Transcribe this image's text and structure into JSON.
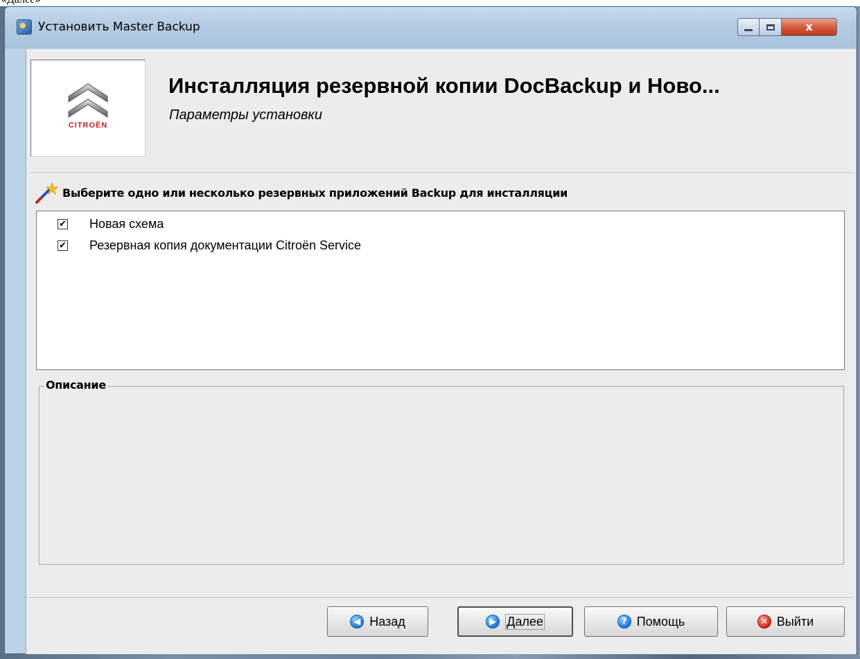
{
  "document_fragment": "«Далее»",
  "window": {
    "title": "Установить Master Backup",
    "controls": {
      "minimize_icon": "minimize-icon",
      "maximize_icon": "maximize-icon",
      "close_icon": "close-icon"
    },
    "close_glyph": "x"
  },
  "header": {
    "logo_brand": "CITROËN",
    "title": "Инсталляция резервной копии DocBackup и Ново...",
    "subtitle": "Параметры установки"
  },
  "selection": {
    "instruction": "Выберите одно или несколько резервных приложений Backup для инсталляции",
    "items": [
      {
        "label": "Новая схема",
        "checked": true
      },
      {
        "label": "Резервная копия документации Citroën Service",
        "checked": true
      }
    ]
  },
  "description": {
    "legend": "Описание",
    "text": ""
  },
  "buttons": {
    "back": "Назад",
    "next": "Далее",
    "help": "Помощь",
    "exit": "Выйти"
  },
  "colors": {
    "titlebar": "#b4cbe2",
    "content_bg": "#ececec",
    "brand_red": "#d01c25",
    "close_button": "#d35d3e"
  }
}
